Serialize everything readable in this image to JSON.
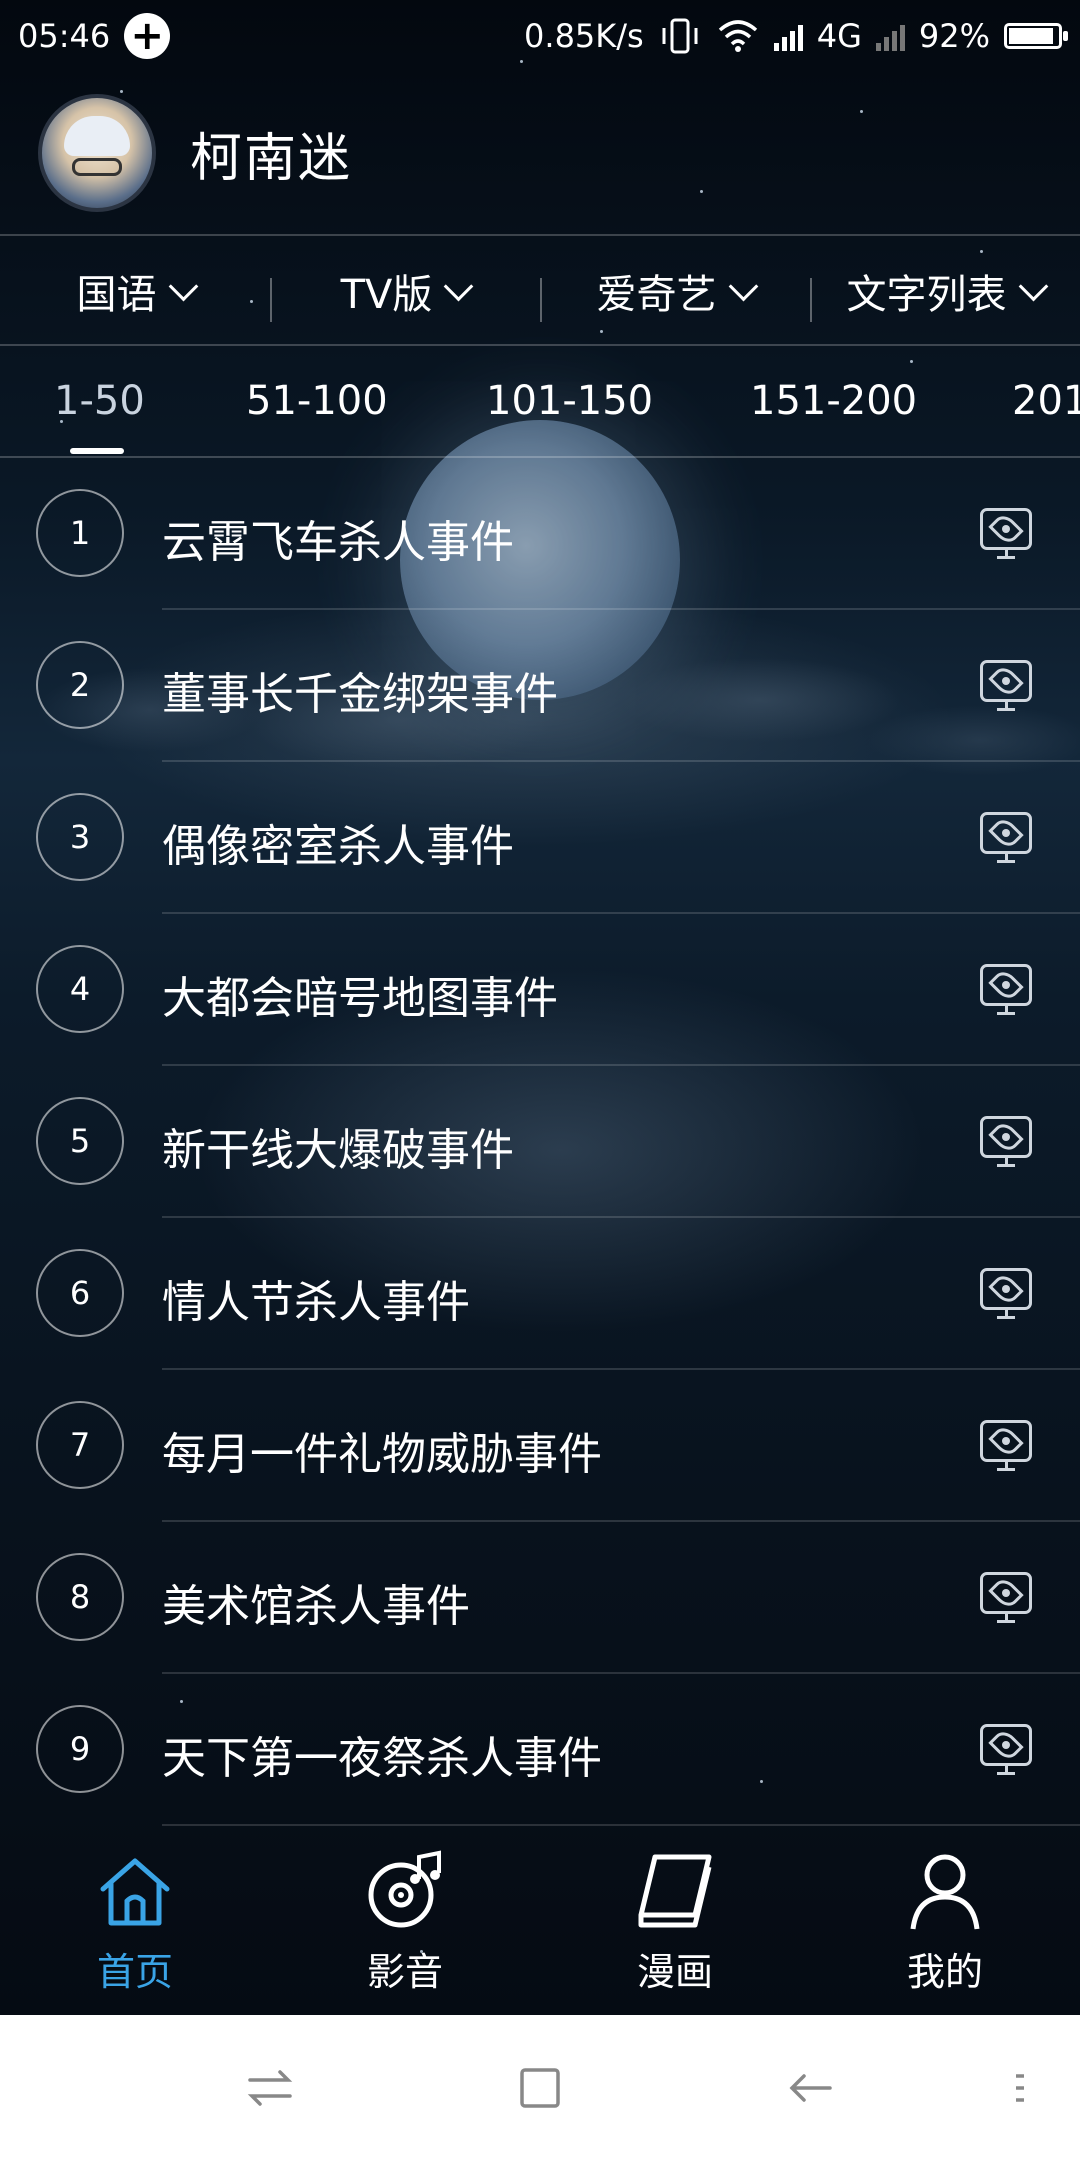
{
  "status_bar": {
    "time": "05:46",
    "network_speed": "0.85K/s",
    "network_type": "4G",
    "battery_percent": "92%",
    "battery_level": 0.92
  },
  "header": {
    "username": "柯南迷"
  },
  "filters": [
    {
      "label": "国语"
    },
    {
      "label": "TV版"
    },
    {
      "label": "爱奇艺"
    },
    {
      "label": "文字列表"
    }
  ],
  "ranges": [
    "1-50",
    "51-100",
    "101-150",
    "151-200",
    "201"
  ],
  "active_range": "1-50",
  "episodes": [
    {
      "number": "1",
      "title": "云霄飞车杀人事件"
    },
    {
      "number": "2",
      "title": "董事长千金绑架事件"
    },
    {
      "number": "3",
      "title": "偶像密室杀人事件"
    },
    {
      "number": "4",
      "title": "大都会暗号地图事件"
    },
    {
      "number": "5",
      "title": "新干线大爆破事件"
    },
    {
      "number": "6",
      "title": "情人节杀人事件"
    },
    {
      "number": "7",
      "title": "每月一件礼物威胁事件"
    },
    {
      "number": "8",
      "title": "美术馆杀人事件"
    },
    {
      "number": "9",
      "title": "天下第一夜祭杀人事件"
    }
  ],
  "bottom_nav": [
    {
      "label": "首页",
      "icon": "home-icon",
      "active": true
    },
    {
      "label": "影音",
      "icon": "music-disc-icon",
      "active": false
    },
    {
      "label": "漫画",
      "icon": "book-icon",
      "active": false
    },
    {
      "label": "我的",
      "icon": "person-icon",
      "active": false
    }
  ],
  "colors": {
    "accent": "#3aa4e6",
    "background": "#07111c"
  }
}
